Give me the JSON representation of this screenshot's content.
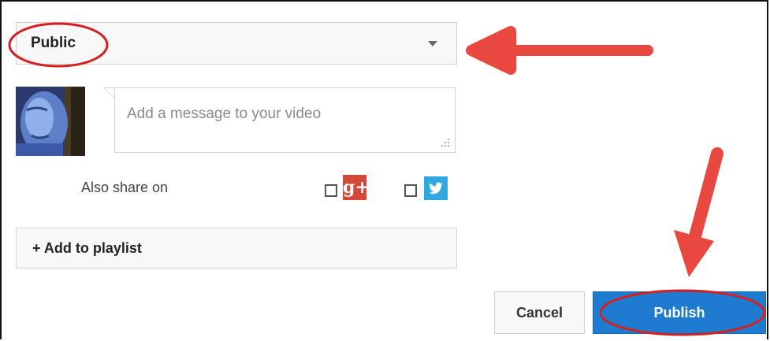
{
  "privacy": {
    "selected": "Public"
  },
  "message": {
    "placeholder": "Add a message to your video"
  },
  "share": {
    "label": "Also share on",
    "gplus_icon_text": "g+",
    "gplus_color": "#d34836",
    "twitter_color": "#2fa9e0"
  },
  "playlist": {
    "label": "+ Add to playlist"
  },
  "actions": {
    "cancel_label": "Cancel",
    "publish_label": "Publish",
    "publish_color": "#1e7bd0"
  },
  "annotations": {
    "arrow_color": "#e8483f",
    "circle_color": "#d61f1f"
  }
}
